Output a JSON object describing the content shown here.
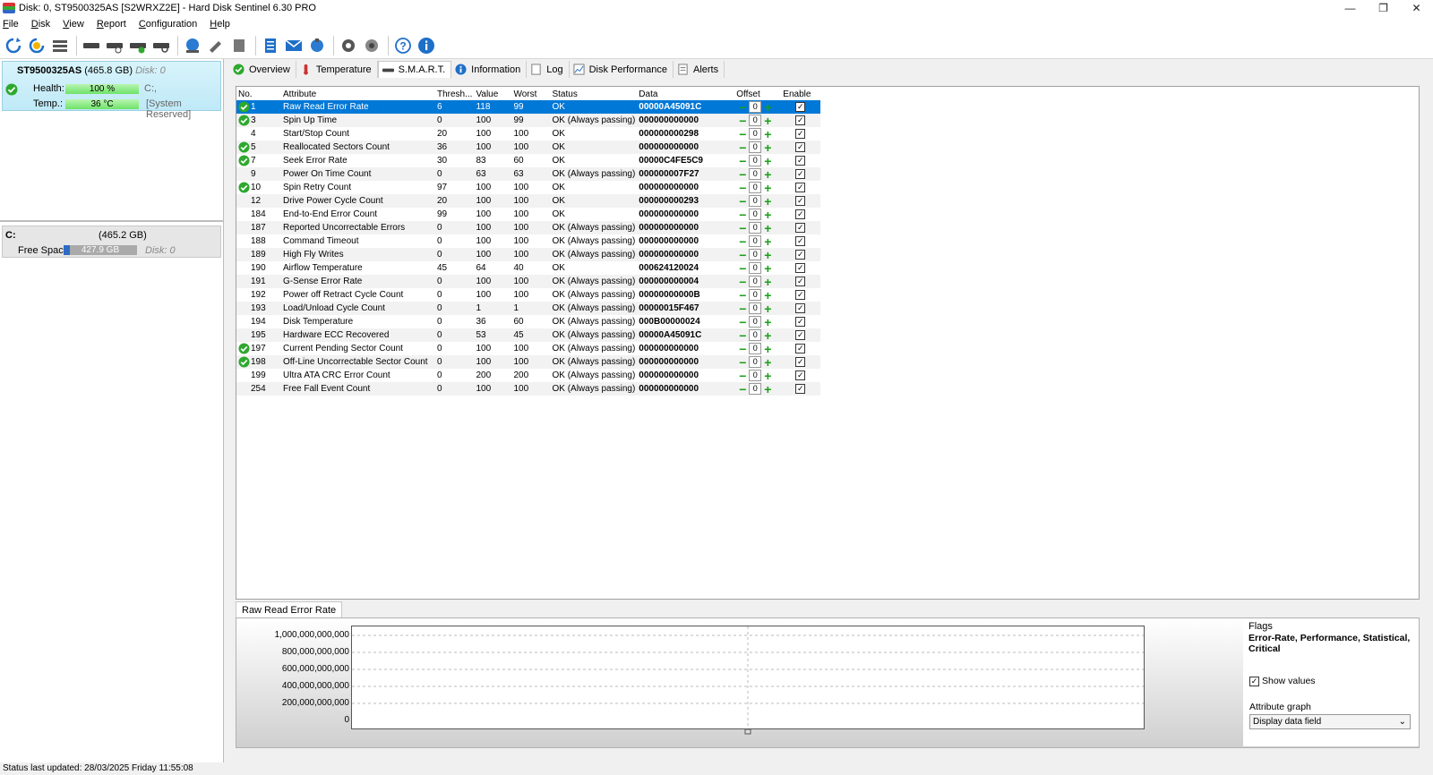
{
  "window": {
    "title": "Disk: 0, ST9500325AS [S2WRXZ2E]  -  Hard Disk Sentinel 6.30 PRO",
    "minimize": "—",
    "restore": "❐",
    "close": "✕"
  },
  "menu": [
    "File",
    "Disk",
    "View",
    "Report",
    "Configuration",
    "Help"
  ],
  "disk": {
    "name": "ST9500325AS",
    "size": "(465.8 GB)",
    "disk_no": "Disk: 0",
    "health_label": "Health:",
    "health_value": "100 %",
    "health_pct": 100,
    "health_volume": "C:,",
    "temp_label": "Temp.:",
    "temp_value": "36 °C",
    "temp_pct": 100,
    "temp_volume": "[System Reserved]"
  },
  "volume": {
    "letter": "C:",
    "size": "(465.2 GB)",
    "free_label": "Free Space",
    "free_value": "427.9 GB",
    "free_pct": 8,
    "disk_no": "Disk: 0"
  },
  "tabs": [
    "Overview",
    "Temperature",
    "S.M.A.R.T.",
    "Information",
    "Log",
    "Disk Performance",
    "Alerts"
  ],
  "columns": [
    "No.",
    "Attribute",
    "Thresh...",
    "Value",
    "Worst",
    "Status",
    "Data",
    "Offset",
    "Enable"
  ],
  "rows": [
    {
      "no": "1",
      "attr": "Raw Read Error Rate",
      "th": "6",
      "val": "118",
      "worst": "99",
      "status": "OK",
      "data": "00000A45091C",
      "offset": "0",
      "ok": true
    },
    {
      "no": "3",
      "attr": "Spin Up Time",
      "th": "0",
      "val": "100",
      "worst": "99",
      "status": "OK (Always passing)",
      "data": "000000000000",
      "offset": "0",
      "ok": true
    },
    {
      "no": "4",
      "attr": "Start/Stop Count",
      "th": "20",
      "val": "100",
      "worst": "100",
      "status": "OK",
      "data": "000000000298",
      "offset": "0",
      "ok": false
    },
    {
      "no": "5",
      "attr": "Reallocated Sectors Count",
      "th": "36",
      "val": "100",
      "worst": "100",
      "status": "OK",
      "data": "000000000000",
      "offset": "0",
      "ok": true
    },
    {
      "no": "7",
      "attr": "Seek Error Rate",
      "th": "30",
      "val": "83",
      "worst": "60",
      "status": "OK",
      "data": "00000C4FE5C9",
      "offset": "0",
      "ok": true
    },
    {
      "no": "9",
      "attr": "Power On Time Count",
      "th": "0",
      "val": "63",
      "worst": "63",
      "status": "OK (Always passing)",
      "data": "000000007F27",
      "offset": "0",
      "ok": false
    },
    {
      "no": "10",
      "attr": "Spin Retry Count",
      "th": "97",
      "val": "100",
      "worst": "100",
      "status": "OK",
      "data": "000000000000",
      "offset": "0",
      "ok": true
    },
    {
      "no": "12",
      "attr": "Drive Power Cycle Count",
      "th": "20",
      "val": "100",
      "worst": "100",
      "status": "OK",
      "data": "000000000293",
      "offset": "0",
      "ok": false
    },
    {
      "no": "184",
      "attr": "End-to-End Error Count",
      "th": "99",
      "val": "100",
      "worst": "100",
      "status": "OK",
      "data": "000000000000",
      "offset": "0",
      "ok": false
    },
    {
      "no": "187",
      "attr": "Reported Uncorrectable Errors",
      "th": "0",
      "val": "100",
      "worst": "100",
      "status": "OK (Always passing)",
      "data": "000000000000",
      "offset": "0",
      "ok": false
    },
    {
      "no": "188",
      "attr": "Command Timeout",
      "th": "0",
      "val": "100",
      "worst": "100",
      "status": "OK (Always passing)",
      "data": "000000000000",
      "offset": "0",
      "ok": false
    },
    {
      "no": "189",
      "attr": "High Fly Writes",
      "th": "0",
      "val": "100",
      "worst": "100",
      "status": "OK (Always passing)",
      "data": "000000000000",
      "offset": "0",
      "ok": false
    },
    {
      "no": "190",
      "attr": "Airflow Temperature",
      "th": "45",
      "val": "64",
      "worst": "40",
      "status": "OK",
      "data": "000624120024",
      "offset": "0",
      "ok": false
    },
    {
      "no": "191",
      "attr": "G-Sense Error Rate",
      "th": "0",
      "val": "100",
      "worst": "100",
      "status": "OK (Always passing)",
      "data": "000000000004",
      "offset": "0",
      "ok": false
    },
    {
      "no": "192",
      "attr": "Power off Retract Cycle Count",
      "th": "0",
      "val": "100",
      "worst": "100",
      "status": "OK (Always passing)",
      "data": "00000000000B",
      "offset": "0",
      "ok": false
    },
    {
      "no": "193",
      "attr": "Load/Unload Cycle Count",
      "th": "0",
      "val": "1",
      "worst": "1",
      "status": "OK (Always passing)",
      "data": "00000015F467",
      "offset": "0",
      "ok": false
    },
    {
      "no": "194",
      "attr": "Disk Temperature",
      "th": "0",
      "val": "36",
      "worst": "60",
      "status": "OK (Always passing)",
      "data": "000B00000024",
      "offset": "0",
      "ok": false
    },
    {
      "no": "195",
      "attr": "Hardware ECC Recovered",
      "th": "0",
      "val": "53",
      "worst": "45",
      "status": "OK (Always passing)",
      "data": "00000A45091C",
      "offset": "0",
      "ok": false
    },
    {
      "no": "197",
      "attr": "Current Pending Sector Count",
      "th": "0",
      "val": "100",
      "worst": "100",
      "status": "OK (Always passing)",
      "data": "000000000000",
      "offset": "0",
      "ok": true
    },
    {
      "no": "198",
      "attr": "Off-Line Uncorrectable Sector Count",
      "th": "0",
      "val": "100",
      "worst": "100",
      "status": "OK (Always passing)",
      "data": "000000000000",
      "offset": "0",
      "ok": true
    },
    {
      "no": "199",
      "attr": "Ultra ATA CRC Error Count",
      "th": "0",
      "val": "200",
      "worst": "200",
      "status": "OK (Always passing)",
      "data": "000000000000",
      "offset": "0",
      "ok": false
    },
    {
      "no": "254",
      "attr": "Free Fall Event Count",
      "th": "0",
      "val": "100",
      "worst": "100",
      "status": "OK (Always passing)",
      "data": "000000000000",
      "offset": "0",
      "ok": false
    }
  ],
  "graph": {
    "tab_label": "Raw Read Error Rate",
    "yticks": [
      "1,000,000,000,000",
      "800,000,000,000",
      "600,000,000,000",
      "400,000,000,000",
      "200,000,000,000",
      "0"
    ],
    "flags_label": "Flags",
    "flags_value": "Error-Rate, Performance, Statistical, Critical",
    "show_values_label": "Show values",
    "attr_graph_label": "Attribute graph",
    "attr_graph_value": "Display data field"
  },
  "status_bar": "Status last updated: 28/03/2025 Friday 11:55:08",
  "colors": {
    "selection": "#0078d7",
    "ok_green": "#2ea82e",
    "health_green": "#6ee36a"
  }
}
